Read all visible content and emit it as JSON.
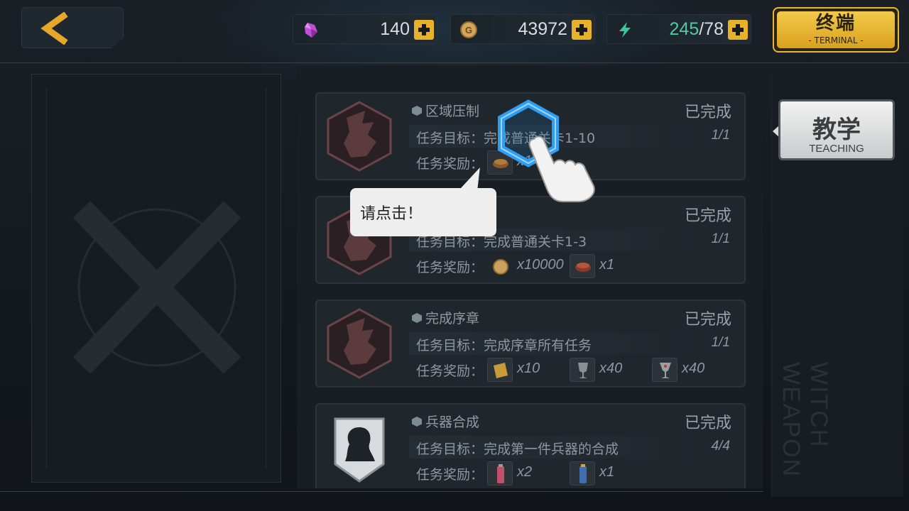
{
  "resources": {
    "crystal": {
      "icon": "crystal-icon",
      "value": "140"
    },
    "gold": {
      "icon": "gold-coin-icon",
      "value": "43972"
    },
    "energy": {
      "icon": "lightning-icon",
      "current": "245",
      "separator": "/78"
    }
  },
  "terminal": {
    "label_zh": "终端",
    "label_en": "- TERMINAL -"
  },
  "teaching": {
    "label_zh": "教学",
    "label_en": "TEACHING"
  },
  "side_watermark": "WITCH WEAPON",
  "tooltip": {
    "text": "请点击！"
  },
  "missions": [
    {
      "title": "区域压制",
      "status": "已完成",
      "goal_label": "任务目标：",
      "goal": "完成普通关卡1-10",
      "progress": "1/1",
      "reward_label": "任务奖励：",
      "rewards": [
        {
          "icon": "ration-icon",
          "qty": "x1"
        }
      ]
    },
    {
      "title": "",
      "status": "已完成",
      "goal_label": "任务目标：",
      "goal": "完成普通关卡1-3",
      "progress": "1/1",
      "reward_label": "任务奖励：",
      "rewards": [
        {
          "icon": "gold-coin-icon",
          "qty": "x10000"
        },
        {
          "icon": "ration-icon",
          "qty": "x1"
        }
      ]
    },
    {
      "title": "完成序章",
      "status": "已完成",
      "goal_label": "任务目标：",
      "goal": "完成序章所有任务",
      "progress": "1/1",
      "reward_label": "任务奖励：",
      "rewards": [
        {
          "icon": "scroll-icon",
          "qty": "x10"
        },
        {
          "icon": "trophy-icon",
          "qty": "x40"
        },
        {
          "icon": "goblet-icon",
          "qty": "x40"
        }
      ]
    },
    {
      "title": "兵器合成",
      "status": "已完成",
      "goal_label": "任务目标：",
      "goal": "完成第一件兵器的合成",
      "progress": "4/4",
      "reward_label": "任务奖励：",
      "rewards": [
        {
          "icon": "exp-potion-red-icon",
          "qty": "x2"
        },
        {
          "icon": "exp-potion-blue-icon",
          "qty": "x1"
        }
      ]
    }
  ]
}
